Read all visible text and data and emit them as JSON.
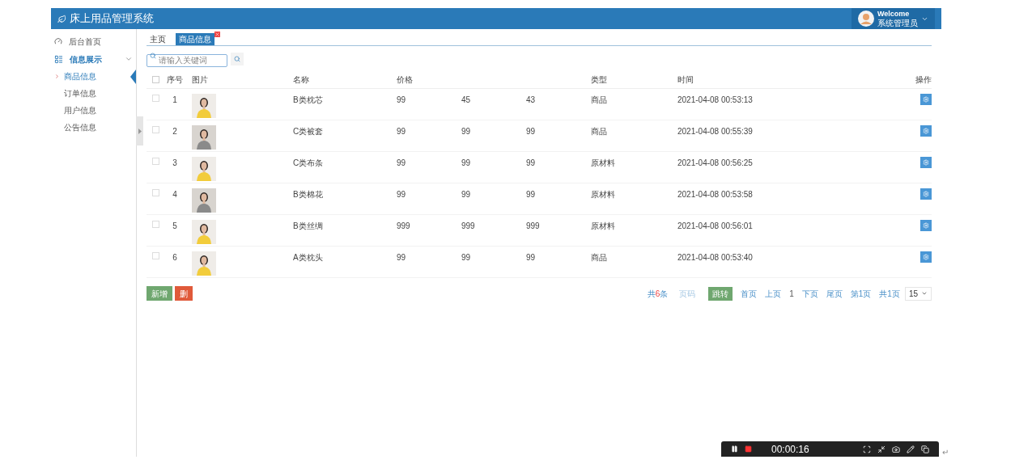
{
  "header": {
    "title": "床上用品管理系统",
    "welcome": "Welcome",
    "user": "系统管理员"
  },
  "sidebar": {
    "items": [
      {
        "label": "后台首页",
        "expanded": false
      },
      {
        "label": "信息展示",
        "expanded": true,
        "children": [
          {
            "label": "商品信息",
            "selected": true
          },
          {
            "label": "订单信息",
            "selected": false
          },
          {
            "label": "用户信息",
            "selected": false
          },
          {
            "label": "公告信息",
            "selected": false
          }
        ]
      }
    ]
  },
  "tabs": [
    {
      "label": "主页",
      "selected": false,
      "closable": false
    },
    {
      "label": "商品信息",
      "selected": true,
      "closable": true
    }
  ],
  "search": {
    "placeholder": "请输入关键词"
  },
  "table": {
    "select_all_checked": false,
    "header": {
      "no": "序号",
      "image": "图片",
      "name": "名称",
      "price": "价格",
      "type": "类型",
      "time": "时间",
      "action": "操作"
    },
    "rows": [
      {
        "checked": false,
        "no": "1",
        "name": "B类枕芯",
        "price": "99",
        "column_5": "45",
        "column_6": "43",
        "type": "商品",
        "time": "2021-04-08 00:53:13"
      },
      {
        "checked": false,
        "no": "2",
        "name": "C类被套",
        "price": "99",
        "column_5": "99",
        "column_6": "99",
        "type": "商品",
        "time": "2021-04-08 00:55:39"
      },
      {
        "checked": false,
        "no": "3",
        "name": "C类布条",
        "price": "99",
        "column_5": "99",
        "column_6": "99",
        "type": "原材料",
        "time": "2021-04-08 00:56:25"
      },
      {
        "checked": false,
        "no": "4",
        "name": "B类棉花",
        "price": "99",
        "column_5": "99",
        "column_6": "99",
        "type": "原材料",
        "time": "2021-04-08 00:53:58"
      },
      {
        "checked": false,
        "no": "5",
        "name": "B类丝绸",
        "price": "999",
        "column_5": "999",
        "column_6": "999",
        "type": "原材料",
        "time": "2021-04-08 00:56:01"
      },
      {
        "checked": false,
        "no": "6",
        "name": "A类枕头",
        "price": "99",
        "column_5": "99",
        "column_6": "99",
        "type": "商品",
        "time": "2021-04-08 00:53:40"
      }
    ]
  },
  "actions": [
    {
      "label": "新增",
      "kind": "add"
    },
    {
      "label": "删",
      "kind": "delete"
    }
  ],
  "pagination": {
    "total_prefix": "共",
    "total_count": "6",
    "total_suffix": "条",
    "page_input_placeholder": "页码",
    "jump": "跳转",
    "first": "首页",
    "prev": "上页",
    "current": "1",
    "next": "下页",
    "last": "尾页",
    "page_of": "第1页",
    "pages": "共1页",
    "page_size": "15"
  },
  "recorder": {
    "time": "00:00:16"
  },
  "paragraph_mark": "↵"
}
